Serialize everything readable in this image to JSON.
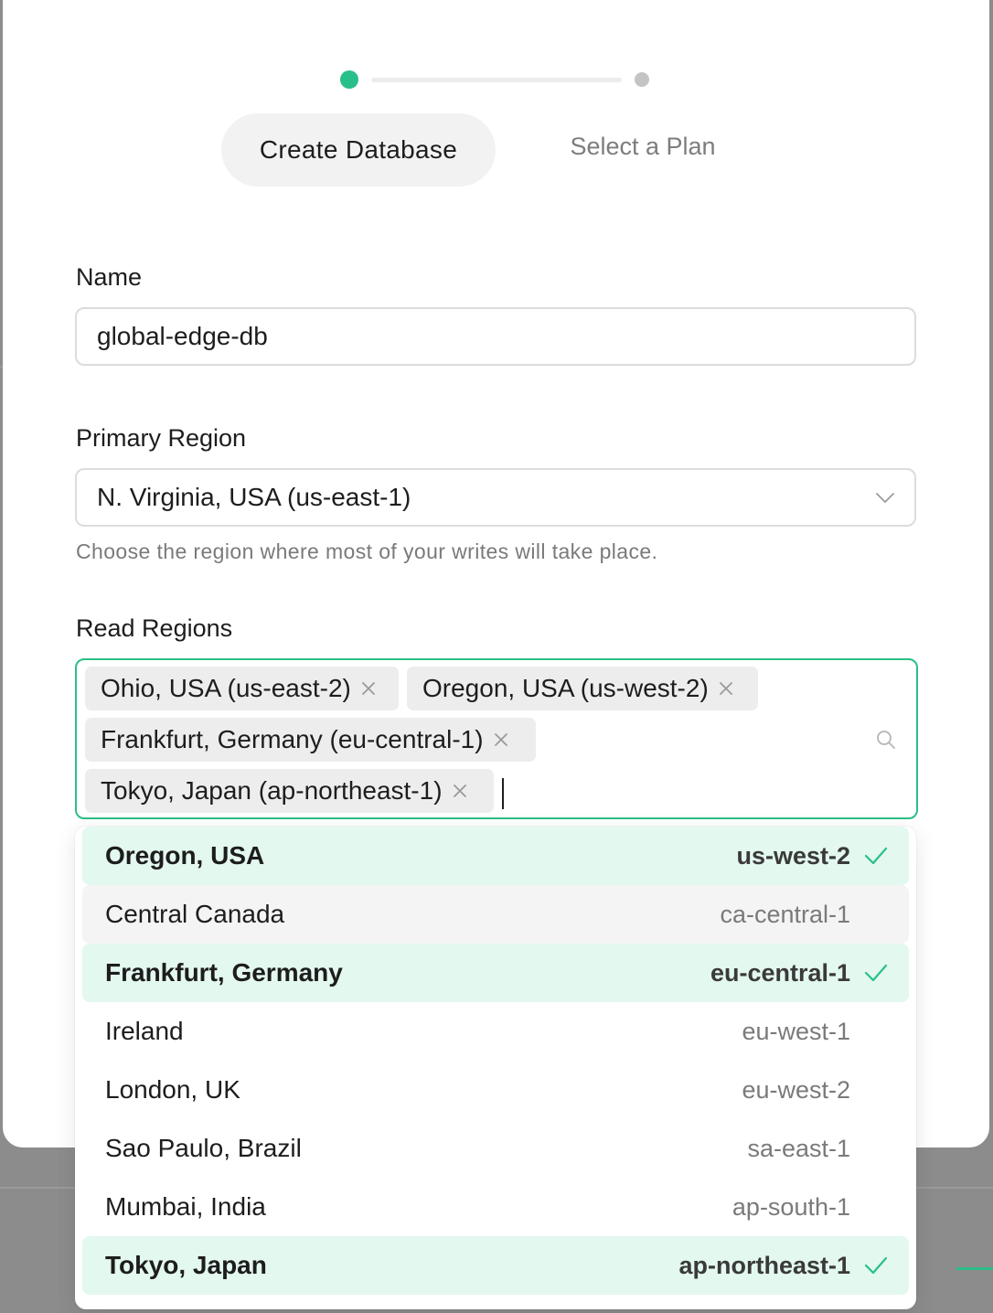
{
  "stepper": {
    "steps": [
      {
        "label": "Create Database",
        "active": true
      },
      {
        "label": "Select a Plan",
        "active": false
      }
    ]
  },
  "form": {
    "name": {
      "label": "Name",
      "value": "global-edge-db"
    },
    "primary_region": {
      "label": "Primary Region",
      "value": "N. Virginia, USA (us-east-1)",
      "helper": "Choose the region where most of your writes will take place."
    },
    "read_regions": {
      "label": "Read Regions",
      "chips": [
        "Ohio, USA (us-east-2)",
        "Oregon, USA (us-west-2)",
        "Frankfurt, Germany (eu-central-1)",
        "Tokyo, Japan (ap-northeast-1)"
      ]
    }
  },
  "dropdown": {
    "options": [
      {
        "name": "Oregon, USA",
        "code": "us-west-2",
        "selected": true
      },
      {
        "name": "Central Canada",
        "code": "ca-central-1",
        "selected": false
      },
      {
        "name": "Frankfurt, Germany",
        "code": "eu-central-1",
        "selected": true
      },
      {
        "name": "Ireland",
        "code": "eu-west-1",
        "selected": false
      },
      {
        "name": "London, UK",
        "code": "eu-west-2",
        "selected": false
      },
      {
        "name": "Sao Paulo, Brazil",
        "code": "sa-east-1",
        "selected": false
      },
      {
        "name": "Mumbai, India",
        "code": "ap-south-1",
        "selected": false
      },
      {
        "name": "Tokyo, Japan",
        "code": "ap-northeast-1",
        "selected": true
      }
    ]
  },
  "colors": {
    "accent": "#27c08a",
    "selected_bg": "#e3f8ee",
    "hover_bg": "#f4f4f4"
  }
}
